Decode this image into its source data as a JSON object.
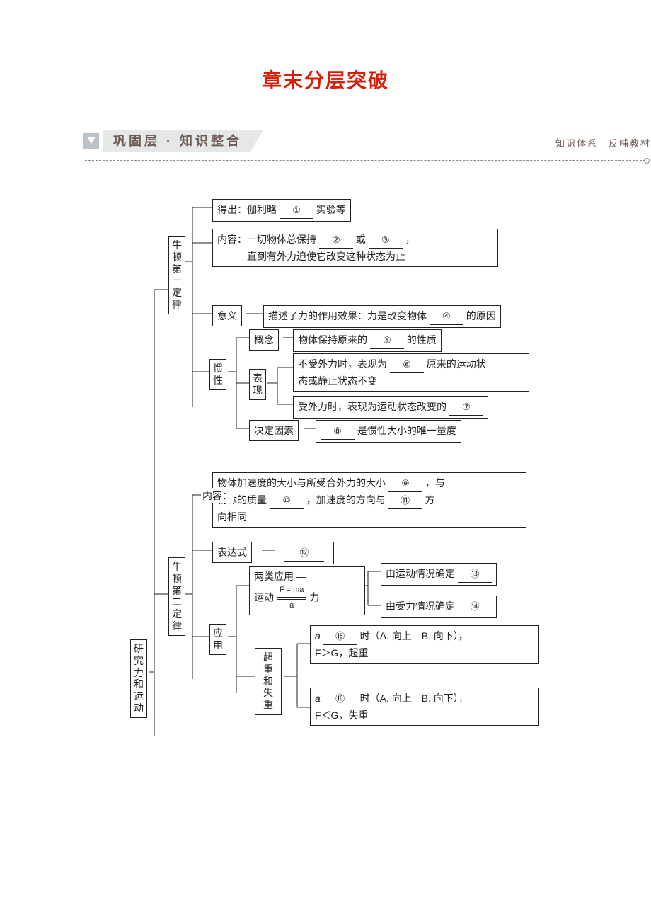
{
  "title": "章末分层突破",
  "section": {
    "heading": "巩固层 · 知识整合",
    "tail": "知识体系　反哺教材"
  },
  "root": "研究力和运动",
  "law1": {
    "label": "牛顿第一定律",
    "derive": {
      "pre": "得出：伽利略",
      "fill": "①",
      "post": "实验等"
    },
    "content": {
      "pre": "内容：一切物体总保持",
      "f1": "②",
      "mid": "或",
      "f2": "③",
      "post": "，",
      "line2": "直到有外力迫使它改变这种状态为止"
    },
    "meaning": {
      "label": "意义",
      "pre": "描述了力的作用效果：力是改变物体",
      "fill": "④",
      "post": "的原因"
    },
    "inertia": {
      "label": "惯性",
      "concept": {
        "label": "概念",
        "pre": "物体保持原来的",
        "fill": "⑤",
        "post": "的性质"
      },
      "perform": {
        "label": "表现",
        "noforce": {
          "pre": "不受外力时，表现为",
          "fill": "⑥",
          "post": "原来的运动状",
          "line2": "态或静止状态不变"
        },
        "force": {
          "pre": "受外力时，表现为运动状态改变的",
          "fill": "⑦"
        }
      },
      "factor": {
        "label": "决定因素",
        "fill": "⑧",
        "post": "是惯性大小的唯一量度"
      }
    }
  },
  "law2": {
    "label": "牛顿第二定律",
    "content": {
      "label": "内容：",
      "l1a": "物体加速度的大小与所受合外力的大小",
      "f1": "⑨",
      "l1b": "，与",
      "l2a": "物体的质量",
      "f2": "⑩",
      "l2b": "，加速度的方向与",
      "f3": "⑪",
      "l2c": "方",
      "l3": "向相同"
    },
    "expr": {
      "label": "表达式",
      "fill": "⑫"
    },
    "app": {
      "label": "应用",
      "two": {
        "label": "两类应用 —",
        "motion": "运动",
        "mid_top": "F = ma",
        "mid_bot": "a",
        "force": "力",
        "det1": {
          "pre": "由运动情况确定",
          "fill": "⑬"
        },
        "det2": {
          "pre": "由受力情况确定",
          "fill": "⑭"
        }
      },
      "ow": {
        "label": "超重和失重",
        "o": {
          "sym": "a",
          "fill": "⑮",
          "opts": "时（A. 向上　B. 向下），",
          "line2": "F＞G，超重"
        },
        "w": {
          "sym": "a",
          "fill": "⑯",
          "opts": "时（A. 向上　B. 向下），",
          "line2": "F＜G，失重"
        }
      }
    }
  }
}
